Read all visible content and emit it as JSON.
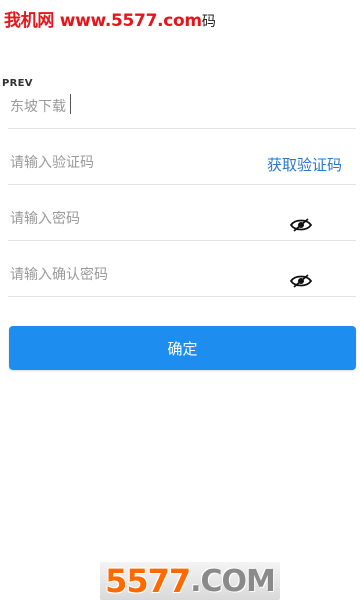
{
  "watermark_top": {
    "site": "我机网 www.5577.com",
    "tail": "码"
  },
  "prev_label": "PREV",
  "form": {
    "username": {
      "value": "东坡下载"
    },
    "code": {
      "placeholder": "请输入验证码",
      "action": "获取验证码"
    },
    "password": {
      "placeholder": "请输入密码",
      "eye_icon": "eye-hidden-icon"
    },
    "confirm_password": {
      "placeholder": "请输入确认密码",
      "eye_icon": "eye-hidden-icon"
    }
  },
  "confirm_button": {
    "label": "确定",
    "color": "#1d8df0"
  },
  "watermark_bottom": {
    "number": "5577",
    "domain": ".COM"
  },
  "colors": {
    "accent_link": "#2a78c9",
    "watermark_red": "#e8141b",
    "watermark_orange": "#ff6a00"
  }
}
